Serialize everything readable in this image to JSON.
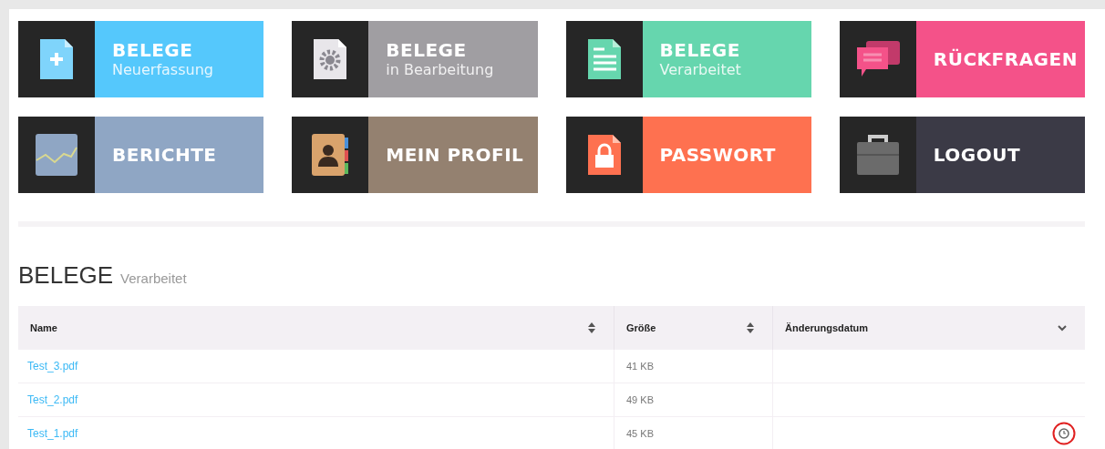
{
  "tiles": [
    {
      "title": "BELEGE",
      "subtitle": "Neuerfassung",
      "color": "#55c8fc",
      "kind": "new"
    },
    {
      "title": "BELEGE",
      "subtitle": "in Bearbeitung",
      "color": "#a09ea2",
      "kind": "editing"
    },
    {
      "title": "BELEGE",
      "subtitle": "Verarbeitet",
      "color": "#66d6ae",
      "kind": "processed"
    },
    {
      "title": "RÜCKFRAGEN",
      "color": "#f45289",
      "kind": "queries"
    },
    {
      "title": "BERICHTE",
      "color": "#8fa6c4",
      "kind": "reports"
    },
    {
      "title": "MEIN PROFIL",
      "color": "#948170",
      "kind": "profile"
    },
    {
      "title": "PASSWORT",
      "color": "#fe7150",
      "kind": "password"
    },
    {
      "title": "LOGOUT",
      "color": "#3b3a46",
      "kind": "logout"
    }
  ],
  "section": {
    "title": "BELEGE",
    "subtitle": "Verarbeitet"
  },
  "table": {
    "columns": [
      {
        "label": "Name",
        "kind": "sortable"
      },
      {
        "label": "Größe",
        "kind": "sortable"
      },
      {
        "label": "Änderungsdatum",
        "kind": "sorted"
      }
    ],
    "rows": [
      {
        "name": "Test_3.pdf",
        "size": "41 KB"
      },
      {
        "name": "Test_2.pdf",
        "size": "49 KB"
      },
      {
        "name": "Test_1.pdf",
        "size": "45 KB",
        "highlighted": true
      }
    ]
  }
}
